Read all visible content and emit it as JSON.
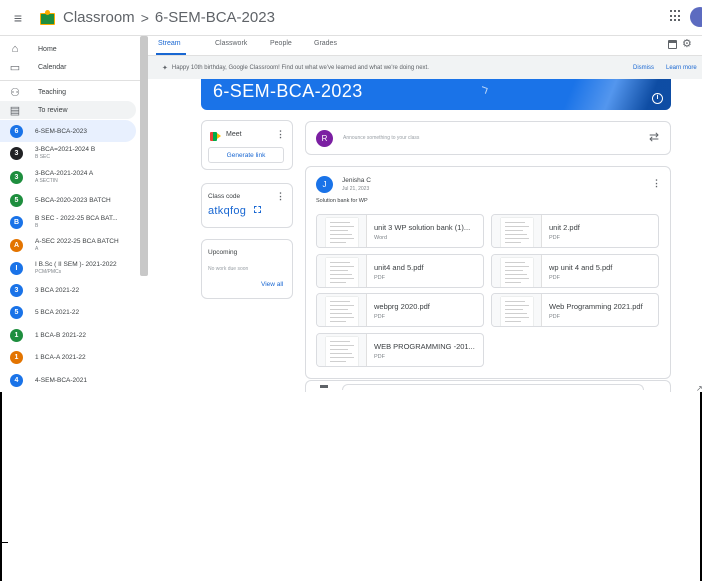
{
  "header": {
    "app_title": "Classroom",
    "separator": ">",
    "class_title": "6-SEM-BCA-2023"
  },
  "sidebar": {
    "nav": [
      {
        "label": "Home",
        "icon": "home-icon"
      },
      {
        "label": "Calendar",
        "icon": "calendar-icon"
      },
      {
        "label": "Teaching",
        "icon": "people-icon"
      },
      {
        "label": "To review",
        "icon": "review-icon"
      }
    ],
    "classes": [
      {
        "initial": "6",
        "name": "6-SEM-BCA-2023",
        "sub": "",
        "color": "#1a73e8"
      },
      {
        "initial": "3",
        "name": "3-BCA=2021-2024 B",
        "sub": "B SEC",
        "color": "#202124"
      },
      {
        "initial": "3",
        "name": "3-BCA-2021-2024 A",
        "sub": "A SECTIN",
        "color": "#1e8e3e"
      },
      {
        "initial": "5",
        "name": "5-BCA-2020-2023 BATCH",
        "sub": "",
        "color": "#1e8e3e"
      },
      {
        "initial": "B",
        "name": "B SEC - 2022-25 BCA BAT...",
        "sub": "B",
        "color": "#1a73e8"
      },
      {
        "initial": "A",
        "name": "A-SEC 2022-25 BCA BATCH",
        "sub": "A",
        "color": "#e37400"
      },
      {
        "initial": "I",
        "name": "I B.Sc ( II SEM )- 2021-2022",
        "sub": "PCM/PMCs",
        "color": "#1a73e8"
      },
      {
        "initial": "3",
        "name": "3 BCA 2021-22",
        "sub": "",
        "color": "#1a73e8"
      },
      {
        "initial": "5",
        "name": "5 BCA 2021-22",
        "sub": "",
        "color": "#1a73e8"
      },
      {
        "initial": "1",
        "name": "1 BCA-B 2021-22",
        "sub": "",
        "color": "#1e8e3e"
      },
      {
        "initial": "1",
        "name": "1 BCA-A 2021-22",
        "sub": "",
        "color": "#e37400"
      },
      {
        "initial": "4",
        "name": "4-SEM-BCA-2021",
        "sub": "",
        "color": "#1a73e8"
      }
    ]
  },
  "tabs": [
    {
      "label": "Stream"
    },
    {
      "label": "Classwork"
    },
    {
      "label": "People"
    },
    {
      "label": "Grades"
    }
  ],
  "banner": {
    "message": "Happy 10th birthday, Google Classroom! Find out what we've learned and what we're doing next.",
    "dismiss": "Dismiss",
    "learn_more": "Learn more"
  },
  "hero": {
    "title": "6-SEM-BCA-2023",
    "info": "i"
  },
  "meet": {
    "label": "Meet",
    "generate": "Generate link"
  },
  "class_code": {
    "label": "Class code",
    "value": "atkqfog"
  },
  "upcoming": {
    "label": "Upcoming",
    "empty": "No work due soon",
    "view_all": "View all"
  },
  "announce": {
    "avatar": "R",
    "placeholder": "Announce something to your class"
  },
  "post": {
    "avatar": "J",
    "author": "Jenisha C",
    "date": "Jul 21, 2023",
    "text": "Solution bank for WP",
    "attachments": [
      {
        "name": "unit 3 WP solution bank (1)...",
        "type": "Word"
      },
      {
        "name": "unit 2.pdf",
        "type": "PDF"
      },
      {
        "name": "unit4 and 5.pdf",
        "type": "PDF"
      },
      {
        "name": "wp unit 4 and 5.pdf",
        "type": "PDF"
      },
      {
        "name": "webprg 2020.pdf",
        "type": "PDF"
      },
      {
        "name": "Web Programming 2021.pdf",
        "type": "PDF"
      },
      {
        "name": "WEB PROGRAMMING -201...",
        "type": "PDF"
      }
    ]
  },
  "colors": {
    "accent": "#1967d2",
    "hero": "#1a73e8",
    "active_bg": "#e8f0fe"
  }
}
